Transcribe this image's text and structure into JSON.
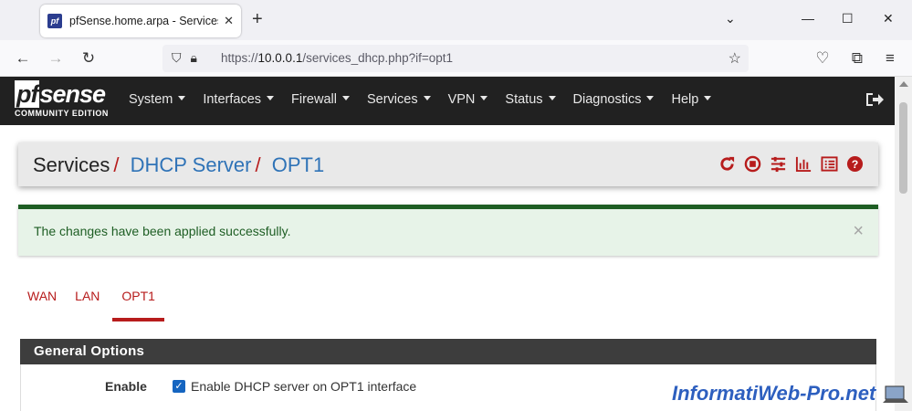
{
  "browser": {
    "tab_title": "pfSense.home.arpa - Services: D",
    "url_prefix": "https://",
    "url_host": "10.0.0.1",
    "url_path": "/services_dhcp.php?if=opt1"
  },
  "pfsense": {
    "logo_text": "pfsense",
    "edition": "COMMUNITY EDITION",
    "menu": [
      "System",
      "Interfaces",
      "Firewall",
      "Services",
      "VPN",
      "Status",
      "Diagnostics",
      "Help"
    ]
  },
  "breadcrumb": {
    "root": "Services",
    "section": "DHCP Server",
    "page": "OPT1",
    "separator": "/"
  },
  "alert": {
    "message": "The changes have been applied successfully.",
    "close": "×"
  },
  "interface_tabs": [
    {
      "label": "WAN",
      "active": false
    },
    {
      "label": "LAN",
      "active": false
    },
    {
      "label": "OPT1",
      "active": true
    }
  ],
  "panel": {
    "title": "General Options",
    "enable_label": "Enable",
    "enable_text": "Enable DHCP server on OPT1 interface",
    "enable_checked": true
  },
  "watermark": "InformatiWeb-Pro.net",
  "colors": {
    "accent_red": "#b71c1c",
    "link_blue": "#2f73b7",
    "success_green": "#1e5e24",
    "header_dark": "#212121"
  }
}
